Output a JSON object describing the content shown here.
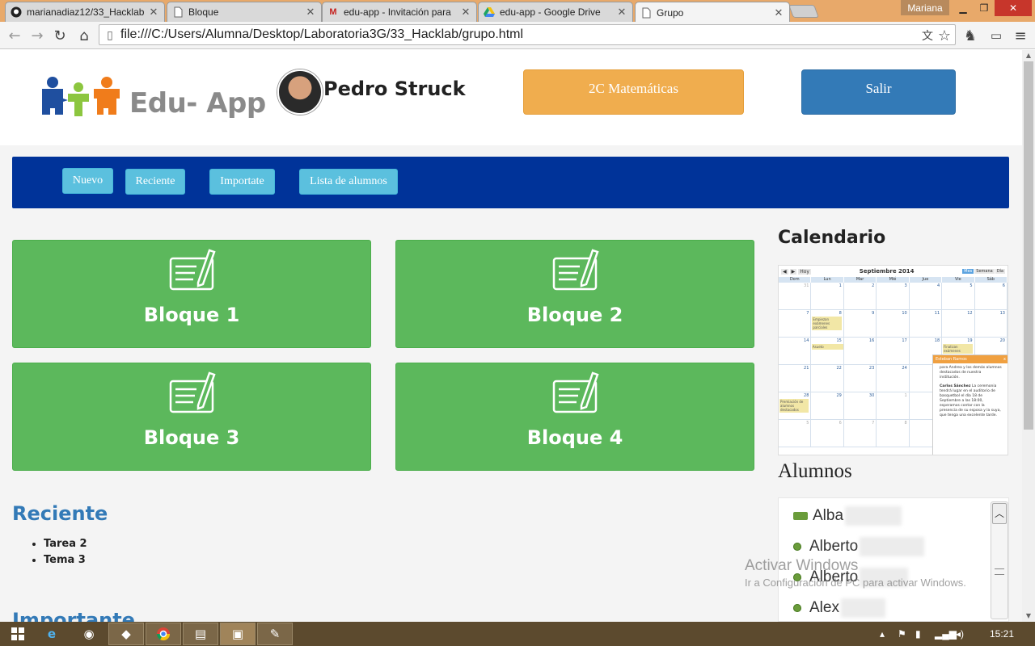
{
  "browser": {
    "tabs": [
      {
        "title": "marianadiaz12/33_Hacklab",
        "icon": "github-icon"
      },
      {
        "title": "Bloque",
        "icon": "page-icon"
      },
      {
        "title": "edu-app - Invitación para",
        "icon": "gmail-icon"
      },
      {
        "title": "edu-app - Google Drive",
        "icon": "drive-icon"
      },
      {
        "title": "Grupo",
        "icon": "page-icon"
      }
    ],
    "user_badge": "Mariana",
    "address": "file:///C:/Users/Alumna/Desktop/Laboratoria3G/33_Hacklab/grupo.html"
  },
  "header": {
    "logo_text": "Edu- App",
    "user_name": "Pedro Struck",
    "class_button": "2C Matemáticas",
    "exit_button": "Salir"
  },
  "nav": {
    "items": [
      "Nuevo",
      "Reciente",
      "Importate",
      "Lista de alumnos"
    ]
  },
  "blocks": [
    {
      "label": "Bloque 1",
      "icon": "notepad-pencil-icon"
    },
    {
      "label": "Bloque 2",
      "icon": "notepad-pencil-icon"
    },
    {
      "label": "Bloque 3",
      "icon": "notepad-pencil-icon"
    },
    {
      "label": "Bloque 4",
      "icon": "notepad-pencil-icon"
    }
  ],
  "recent": {
    "title": "Reciente",
    "items": [
      "Tarea 2",
      "Tema 3"
    ]
  },
  "important": {
    "title": "Importante"
  },
  "sidebar": {
    "calendar_title": "Calendario",
    "calendar": {
      "month": "Septiembre 2014",
      "today_button": "Hoy",
      "views": [
        "Mes",
        "Semana",
        "Día"
      ],
      "weekdays": [
        "Dom",
        "Lun",
        "Mar",
        "Mié",
        "Jue",
        "Vie",
        "Sáb"
      ],
      "events": [
        "Empiezan exámenes parciales",
        "Asueto",
        "Finalizan exámenes",
        "Premiación de alumnos destacados"
      ],
      "popup_header": "Esteban Ramos",
      "popup_text_1": "para Andrea y los demás alumnos destacados de nuestra institución.",
      "popup_author": "Carlos Sánchez",
      "popup_text_2": "La ceremonia tendrá lugar en el auditorio de basquetbol el día 18 de Septiembre a las 18:00, esperamos contar con la presencia de su esposa y la suya, que tenga una excelente tarde."
    },
    "students_title": "Alumnos",
    "students": [
      {
        "name": "Alba",
        "status": "video"
      },
      {
        "name": "Alberto",
        "status": "online"
      },
      {
        "name": "Alberto",
        "status": "online"
      },
      {
        "name": "Alex",
        "status": "online"
      }
    ]
  },
  "watermark": {
    "line1": "Activar Windows",
    "line2": "Ir a Configuración de PC para activar Windows."
  },
  "taskbar": {
    "clock": "15:21"
  },
  "colors": {
    "orange": "#f0ad4e",
    "blue": "#337ab7",
    "navy": "#003399",
    "cyan": "#5bc0de",
    "green": "#5cb85c"
  }
}
